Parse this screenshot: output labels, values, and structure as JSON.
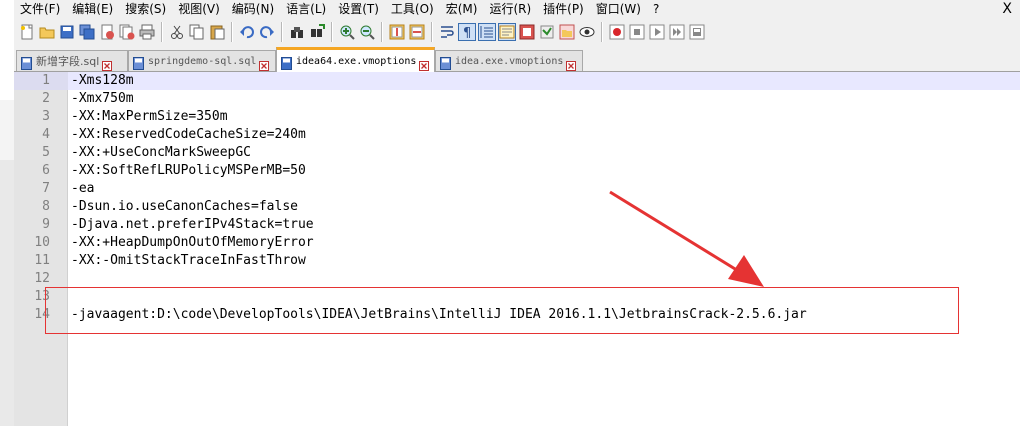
{
  "menu": {
    "items": [
      "文件(F)",
      "编辑(E)",
      "搜索(S)",
      "视图(V)",
      "编码(N)",
      "语言(L)",
      "设置(T)",
      "工具(O)",
      "宏(M)",
      "运行(R)",
      "插件(P)",
      "窗口(W)",
      "?"
    ],
    "close_glyph": "X"
  },
  "toolbar": {
    "icons": [
      "new-file-icon",
      "open-file-icon",
      "save-icon",
      "save-all-icon",
      "close-icon",
      "close-all-icon",
      "print-icon",
      "cut-icon",
      "copy-icon",
      "paste-icon",
      "undo-icon",
      "redo-icon",
      "find-icon",
      "replace-icon",
      "zoom-in-icon",
      "zoom-out-icon",
      "sync-vertical-icon",
      "sync-horizontal-icon",
      "word-wrap-icon",
      "show-all-chars-icon",
      "indent-guide-icon",
      "user-language-icon",
      "doc-map-icon",
      "function-list-icon",
      "folder-workspace-icon",
      "monitoring-icon",
      "record-macro-icon",
      "stop-record-icon",
      "play-macro-icon",
      "run-macro-multiple-icon",
      "save-macro-icon"
    ]
  },
  "tabs": [
    {
      "label": "新增字段.sql",
      "active": false,
      "cjk": true
    },
    {
      "label": "springdemo-sql.sql",
      "active": false,
      "cjk": false
    },
    {
      "label": "idea64.exe.vmoptions",
      "active": true,
      "cjk": false
    },
    {
      "label": "idea.exe.vmoptions",
      "active": false,
      "cjk": false
    }
  ],
  "editor": {
    "lines": [
      {
        "n": "1",
        "text": "-Xms128m"
      },
      {
        "n": "2",
        "text": "-Xmx750m"
      },
      {
        "n": "3",
        "text": "-XX:MaxPermSize=350m"
      },
      {
        "n": "4",
        "text": "-XX:ReservedCodeCacheSize=240m"
      },
      {
        "n": "5",
        "text": "-XX:+UseConcMarkSweepGC"
      },
      {
        "n": "6",
        "text": "-XX:SoftRefLRUPolicyMSPerMB=50"
      },
      {
        "n": "7",
        "text": "-ea"
      },
      {
        "n": "8",
        "text": "-Dsun.io.useCanonCaches=false"
      },
      {
        "n": "9",
        "text": "-Djava.net.preferIPv4Stack=true"
      },
      {
        "n": "10",
        "text": "-XX:+HeapDumpOnOutOfMemoryError"
      },
      {
        "n": "11",
        "text": "-XX:-OmitStackTraceInFastThrow"
      },
      {
        "n": "12",
        "text": ""
      },
      {
        "n": "13",
        "text": ""
      },
      {
        "n": "14",
        "text": "-javaagent:D:\\code\\DevelopTools\\IDEA\\JetBrains\\IntelliJ IDEA 2016.1.1\\JetbrainsCrack-2.5.6.jar"
      }
    ],
    "current_line": 1
  },
  "colors": {
    "annotation": "#e53333",
    "active_tab_accent": "#f5a623",
    "current_line_bg": "#e8e8ff"
  }
}
